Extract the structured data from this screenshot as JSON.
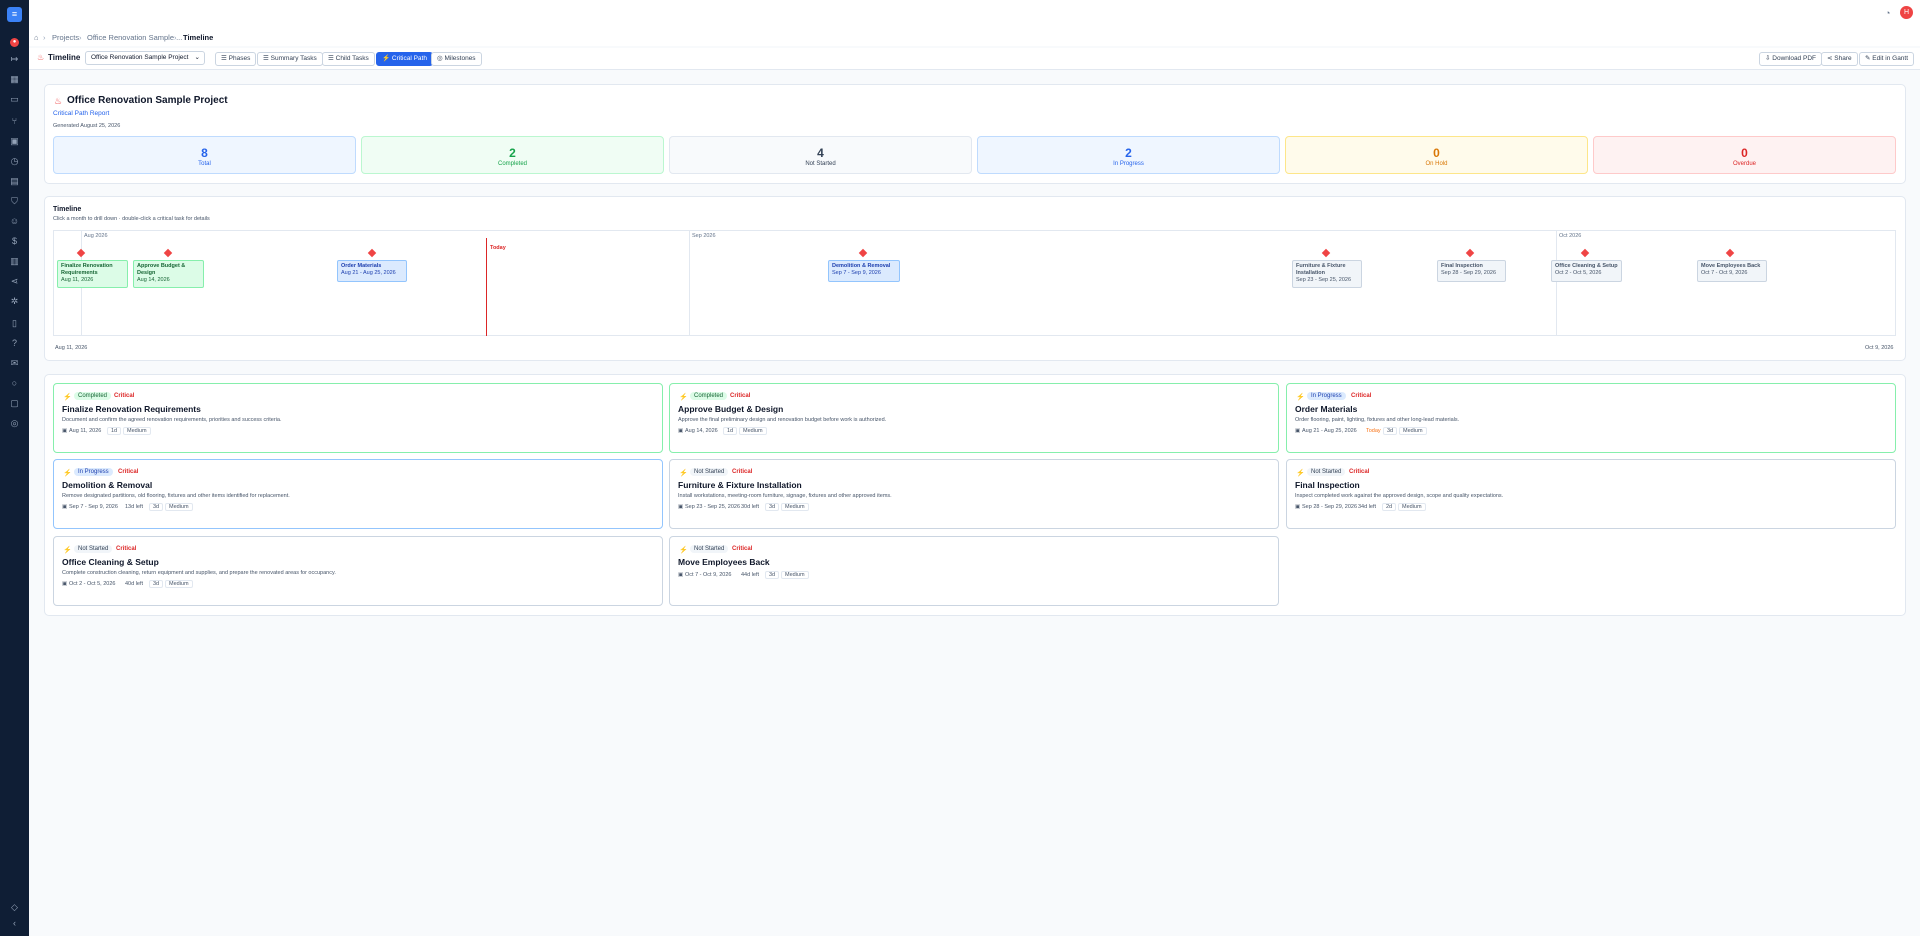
{
  "breadcrumb": {
    "items": [
      "Projects",
      "Office Renovation Sample ...",
      "Timeline"
    ]
  },
  "header": {
    "user_initial": "H"
  },
  "toolbar": {
    "title": "Timeline",
    "project_select": "Office Renovation Sample Project",
    "tabs": [
      "Phases",
      "Summary Tasks",
      "Child Tasks",
      "Critical Path",
      "Milestones"
    ],
    "active_tab": "Critical Path",
    "actions": [
      "Download PDF",
      "Share",
      "Edit in Gantt"
    ]
  },
  "report": {
    "project_name": "Office Renovation Sample Project",
    "subtitle": "Critical Path Report",
    "generated": "Generated August 25, 2026",
    "stats": [
      {
        "value": "8",
        "label": "Total",
        "color": "#2563eb"
      },
      {
        "value": "2",
        "label": "Completed",
        "color": "#16a34a"
      },
      {
        "value": "4",
        "label": "Not Started",
        "color": "#334155"
      },
      {
        "value": "2",
        "label": "In Progress",
        "color": "#2563eb"
      },
      {
        "value": "0",
        "label": "On Hold",
        "color": "#d97706"
      },
      {
        "value": "0",
        "label": "Overdue",
        "color": "#dc2626"
      }
    ]
  },
  "timeline": {
    "title": "Timeline",
    "hint": "Click a month to drill down · double-click a critical task for details",
    "months": [
      "Aug 2026",
      "Sep 2026",
      "Oct 2026"
    ],
    "today_label": "Today",
    "start_label": "Aug 11, 2026",
    "end_label": "Oct 9, 2026",
    "tasks": [
      {
        "name": "Finalize Renovation Requirements",
        "dates": "Aug 11, 2026"
      },
      {
        "name": "Approve Budget & Design",
        "dates": "Aug 14, 2026"
      },
      {
        "name": "Order Materials",
        "dates": "Aug 21 - Aug 25, 2026"
      },
      {
        "name": "Demolition & Removal",
        "dates": "Sep 7 - Sep 9, 2026"
      },
      {
        "name": "Furniture & Fixture Installation",
        "dates": "Sep 23 - Sep 25, 2026"
      },
      {
        "name": "Final Inspection",
        "dates": "Sep 28 - Sep 29, 2026"
      },
      {
        "name": "Office Cleaning & Setup",
        "dates": "Oct 2 - Oct 5, 2026"
      },
      {
        "name": "Move Employees Back",
        "dates": "Oct 7 - Oct 9, 2026"
      }
    ]
  },
  "task_cards": [
    {
      "status": "Completed",
      "critical": "Critical",
      "title": "Finalize Renovation Requirements",
      "desc": "Document and confirm the agreed renovation requirements, priorities and success criteria.",
      "date": "Aug 11, 2026",
      "left": "",
      "duration": "1d",
      "priority": "Medium"
    },
    {
      "status": "Completed",
      "critical": "Critical",
      "title": "Approve Budget & Design",
      "desc": "Approve the final preliminary design and renovation budget before work is authorized.",
      "date": "Aug 14, 2026",
      "left": "",
      "duration": "1d",
      "priority": "Medium"
    },
    {
      "status": "In Progress",
      "critical": "Critical",
      "title": "Order Materials",
      "desc": "Order flooring, paint, lighting, fixtures and other long-lead materials.",
      "date": "Aug 21 - Aug 25, 2026",
      "left": "Today",
      "duration": "3d",
      "priority": "Medium"
    },
    {
      "status": "In Progress",
      "critical": "Critical",
      "title": "Demolition & Removal",
      "desc": "Remove designated partitions, old flooring, fixtures and other items identified for replacement.",
      "date": "Sep 7 - Sep 9, 2026",
      "left": "13d left",
      "duration": "3d",
      "priority": "Medium"
    },
    {
      "status": "Not Started",
      "critical": "Critical",
      "title": "Furniture & Fixture Installation",
      "desc": "Install workstations, meeting-room furniture, signage, fixtures and other approved items.",
      "date": "Sep 23 - Sep 25, 2026",
      "left": "30d left",
      "duration": "3d",
      "priority": "Medium"
    },
    {
      "status": "Not Started",
      "critical": "Critical",
      "title": "Final Inspection",
      "desc": "Inspect completed work against the approved design, scope and quality expectations.",
      "date": "Sep 28 - Sep 29, 2026",
      "left": "34d left",
      "duration": "2d",
      "priority": "Medium"
    },
    {
      "status": "Not Started",
      "critical": "Critical",
      "title": "Office Cleaning & Setup",
      "desc": "Complete construction cleaning, return equipment and supplies, and prepare the renovated areas for occupancy.",
      "date": "Oct 2 - Oct 5, 2026",
      "left": "40d left",
      "duration": "3d",
      "priority": "Medium"
    },
    {
      "status": "Not Started",
      "critical": "Critical",
      "title": "Move Employees Back",
      "desc": "",
      "date": "Oct 7 - Oct 9, 2026",
      "left": "44d left",
      "duration": "3d",
      "priority": "Medium"
    }
  ]
}
